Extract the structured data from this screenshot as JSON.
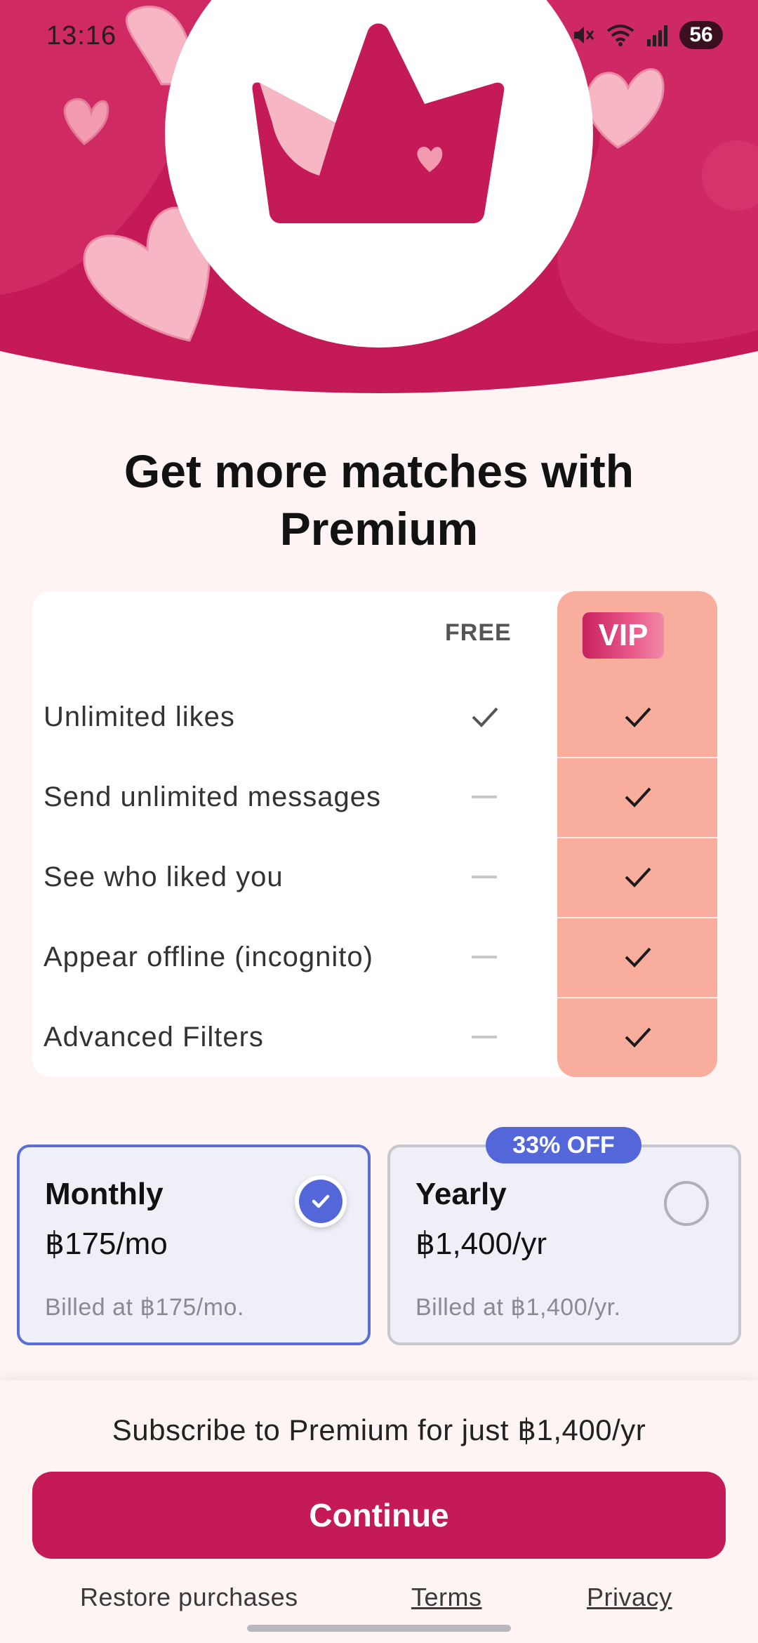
{
  "status_bar": {
    "time": "13:16",
    "battery": "56",
    "icons": [
      "mute-icon",
      "wifi-icon",
      "signal-icon",
      "battery-icon"
    ]
  },
  "hero": {
    "icons": [
      "crown-icon",
      "heart-icon"
    ],
    "colors": {
      "primary": "#c41a58",
      "heart": "#f7b6c4"
    }
  },
  "headline": "Get more matches with Premium",
  "compare": {
    "free_header": "FREE",
    "vip_header": "VIP",
    "features": [
      {
        "label": "Unlimited likes",
        "free": "included",
        "vip": "included"
      },
      {
        "label": "Send unlimited messages",
        "free": "not-included",
        "vip": "included"
      },
      {
        "label": "See who liked you",
        "free": "not-included",
        "vip": "included"
      },
      {
        "label": "Appear offline (incognito)",
        "free": "not-included",
        "vip": "included"
      },
      {
        "label": "Advanced Filters",
        "free": "not-included",
        "vip": "included"
      }
    ]
  },
  "plans": {
    "monthly": {
      "name": "Monthly",
      "price": "฿175/mo",
      "billed": "Billed at ฿175/mo.",
      "selected": true
    },
    "yearly": {
      "name": "Yearly",
      "price": "฿1,400/yr",
      "billed": "Billed at ฿1,400/yr.",
      "badge": "33% OFF",
      "selected": false
    }
  },
  "footer": {
    "subscribe_text": "Subscribe to Premium for just ฿1,400/yr",
    "continue_label": "Continue",
    "restore_label": "Restore purchases",
    "terms_label": "Terms",
    "privacy_label": "Privacy"
  }
}
